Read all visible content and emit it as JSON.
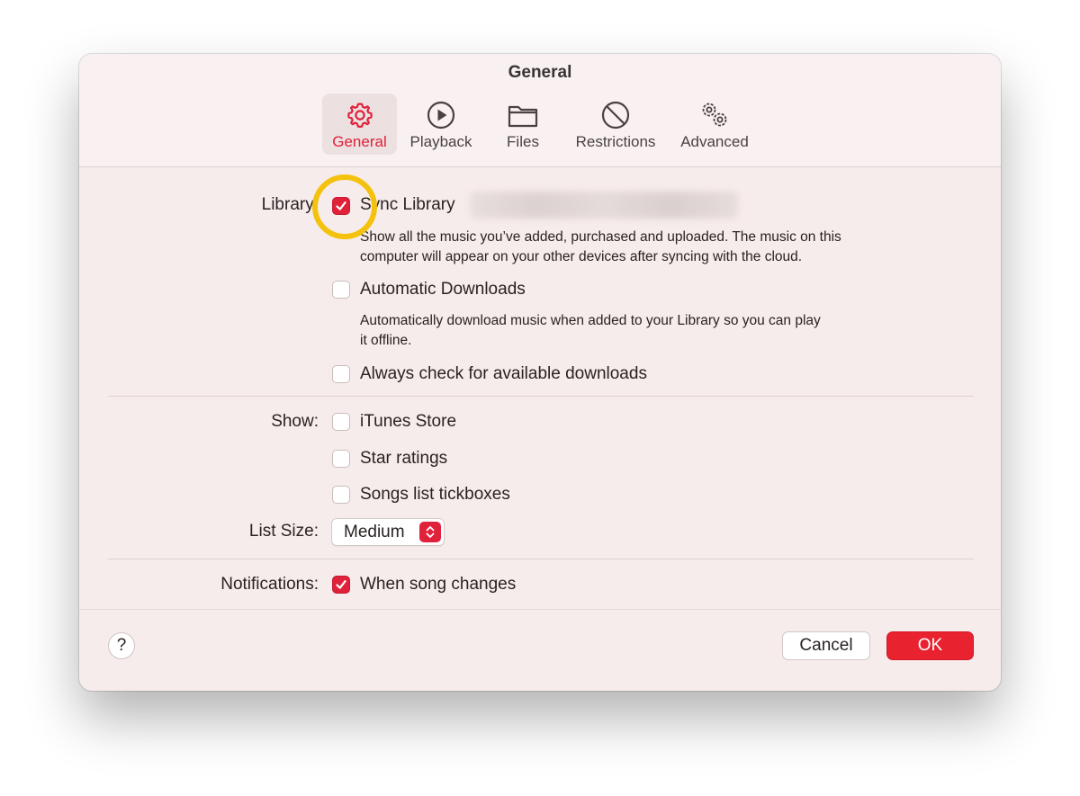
{
  "window": {
    "title": "General"
  },
  "tabs": [
    {
      "label": "General",
      "icon": "gear-icon",
      "selected": true
    },
    {
      "label": "Playback",
      "icon": "play-circle-icon",
      "selected": false
    },
    {
      "label": "Files",
      "icon": "folder-icon",
      "selected": false
    },
    {
      "label": "Restrictions",
      "icon": "prohibited-icon",
      "selected": false
    },
    {
      "label": "Advanced",
      "icon": "gears-icon",
      "selected": false
    }
  ],
  "library": {
    "label": "Library:",
    "sync": {
      "label": "Sync Library",
      "checked": true,
      "description_line1": "Show all the music you’ve added, purchased and uploaded. The music on this",
      "description_line2": "computer will appear on your other devices after syncing with the cloud."
    },
    "auto_downloads": {
      "label": "Automatic Downloads",
      "checked": false,
      "description_line1": "Automatically download music when added to your Library so you can play",
      "description_line2": "it offline."
    },
    "always_check": {
      "label": "Always check for available downloads",
      "checked": false
    }
  },
  "show": {
    "label": "Show:",
    "itunes_store": {
      "label": "iTunes Store",
      "checked": false
    },
    "star_ratings": {
      "label": "Star ratings",
      "checked": false
    },
    "songs_tickboxes": {
      "label": "Songs list tickboxes",
      "checked": false
    }
  },
  "list_size": {
    "label": "List Size:",
    "value": "Medium"
  },
  "notifications": {
    "label": "Notifications:",
    "song_changes": {
      "label": "When song changes",
      "checked": true
    }
  },
  "footer": {
    "help": "?",
    "cancel": "Cancel",
    "ok": "OK"
  },
  "colors": {
    "accent": "#e0213a",
    "highlight_ring": "#f4c20d",
    "window_bg": "#f7ecec"
  }
}
